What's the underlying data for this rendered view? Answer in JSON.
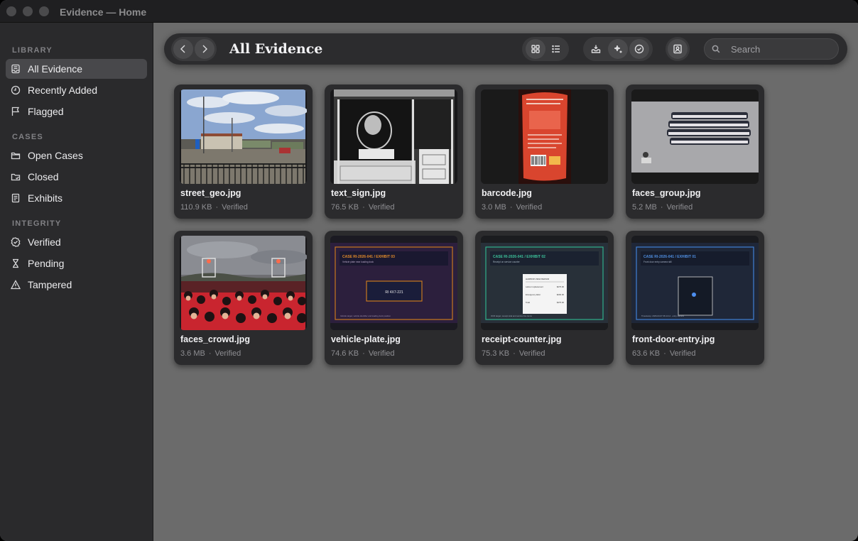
{
  "window": {
    "title": "Evidence — Home"
  },
  "sidebar": {
    "sections": {
      "library": "LIBRARY",
      "cases": "CASES",
      "integrity": "INTEGRITY"
    },
    "items": [
      {
        "label": "All Evidence",
        "icon": "archive-box-icon",
        "active": true
      },
      {
        "label": "Recently Added",
        "icon": "clock-icon",
        "active": false
      },
      {
        "label": "Flagged",
        "icon": "flag-icon",
        "active": false
      },
      {
        "label": "Open Cases",
        "icon": "folder-icon",
        "active": false
      },
      {
        "label": "Closed",
        "icon": "folder-check-icon",
        "active": false
      },
      {
        "label": "Exhibits",
        "icon": "document-icon",
        "active": false
      },
      {
        "label": "Verified",
        "icon": "verified-badge-icon",
        "active": false
      },
      {
        "label": "Pending",
        "icon": "hourglass-icon",
        "active": false
      },
      {
        "label": "Tampered",
        "icon": "warning-triangle-icon",
        "active": false
      }
    ]
  },
  "toolbar": {
    "title": "All Evidence",
    "search_placeholder": "Search",
    "buttons": [
      "back-icon",
      "forward-icon",
      "grid-view-icon",
      "list-view-icon",
      "import-tray-icon",
      "sparkle-icon",
      "verify-badge-icon",
      "contact-card-icon"
    ]
  },
  "evidence": [
    {
      "name": "street_geo.jpg",
      "size": "110.9 KB",
      "status": "Verified"
    },
    {
      "name": "text_sign.jpg",
      "size": "76.5 KB",
      "status": "Verified"
    },
    {
      "name": "barcode.jpg",
      "size": "3.0 MB",
      "status": "Verified"
    },
    {
      "name": "faces_group.jpg",
      "size": "5.2 MB",
      "status": "Verified"
    },
    {
      "name": "faces_crowd.jpg",
      "size": "3.6 MB",
      "status": "Verified"
    },
    {
      "name": "vehicle-plate.jpg",
      "size": "74.6 KB",
      "status": "Verified"
    },
    {
      "name": "receipt-counter.jpg",
      "size": "75.3 KB",
      "status": "Verified"
    },
    {
      "name": "front-door-entry.jpg",
      "size": "63.6 KB",
      "status": "Verified"
    }
  ],
  "thumbnails": {
    "vehicle": {
      "heading": "CASE RI-2026-041 / EXHIBIT 03",
      "sub": "Vehicle plate near loading dock",
      "plate": "RI 4X7-221",
      "footer": "Vehicle target; vehicle identifier and loading dock position"
    },
    "receipt": {
      "heading": "CASE RI-2026-041 / EXHIBIT 02",
      "sub": "Receipt on service counter",
      "shop": "HARBOR VIEW REPAIR",
      "l1": "Labour replacement",
      "v1": "$275.00",
      "l2": "Emergency labor",
      "v2": "$200.00",
      "l3": "Total",
      "v3": "$475.00",
      "footer": "OCR target; receipt total and service line items"
    },
    "door": {
      "heading": "CASE RI-2026-041 / EXHIBIT 01",
      "sub": "Front door entry camera still",
      "footer": "Timestamp: 2026-03-07 06:11:14 · entry camera"
    }
  },
  "colors": {
    "accent_orange": "#c9781f",
    "accent_teal": "#2fb08a",
    "accent_blue": "#3f7fd6"
  }
}
